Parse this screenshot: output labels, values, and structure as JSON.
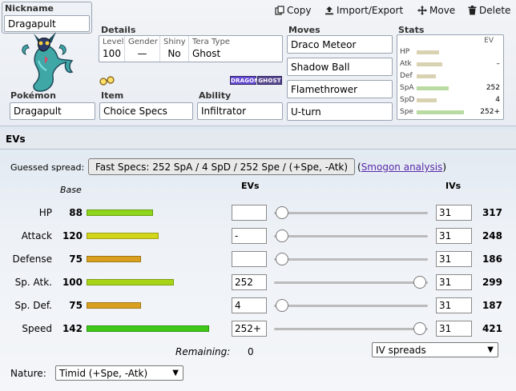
{
  "toolbar": {
    "copy": "Copy",
    "import_export": "Import/Export",
    "move": "Move",
    "delete": "Delete"
  },
  "nickname": {
    "label": "Nickname",
    "value": "Dragapult"
  },
  "details": {
    "label": "Details",
    "level_label": "Level",
    "level": "100",
    "gender_label": "Gender",
    "gender": "—",
    "shiny_label": "Shiny",
    "shiny": "No",
    "tera_label": "Tera Type",
    "tera": "Ghost"
  },
  "types": [
    {
      "name": "DRAGON",
      "color": "#6a4bd6"
    },
    {
      "name": "GHOST",
      "color": "#5b4a8f"
    }
  ],
  "pokemon": {
    "label": "Pokémon",
    "value": "Dragapult"
  },
  "item": {
    "label": "Item",
    "value": "Choice Specs"
  },
  "ability": {
    "label": "Ability",
    "value": "Infiltrator"
  },
  "moves": {
    "label": "Moves",
    "list": [
      "Draco Meteor",
      "Shadow Ball",
      "Flamethrower",
      "U-turn"
    ]
  },
  "stats_mini": {
    "label": "Stats",
    "ev_header": "EV",
    "rows": [
      {
        "name": "HP",
        "bar": 0.45,
        "ev": ""
      },
      {
        "name": "Atk",
        "bar": 0.52,
        "ev": "–"
      },
      {
        "name": "Def",
        "bar": 0.38,
        "ev": ""
      },
      {
        "name": "SpA",
        "bar": 0.65,
        "ev": "252"
      },
      {
        "name": "SpD",
        "bar": 0.4,
        "ev": "4"
      },
      {
        "name": "Spe",
        "bar": 0.95,
        "ev": "252+"
      }
    ]
  },
  "evs_panel": {
    "title": "EVs",
    "guessed_label": "Guessed spread:",
    "guessed_value": "Fast Specs: 252 SpA / 4 SpD / 252 Spe / (+Spe, -Atk)",
    "paren_open": "(",
    "smogon_link": "Smogon analysis",
    "paren_close": ")",
    "base_header": "Base",
    "evs_header": "EVs",
    "ivs_header": "IVs",
    "stats": [
      {
        "name": "HP",
        "base": "88",
        "base_frac": 0.336,
        "color": "#8ed41a",
        "ev": "",
        "ev_frac": 0.0,
        "iv": "31",
        "total": "317"
      },
      {
        "name": "Attack",
        "base": "120",
        "base_frac": 0.366,
        "color": "#d2d61a",
        "ev": "-",
        "ev_frac": 0.0,
        "iv": "31",
        "total": "248"
      },
      {
        "name": "Defense",
        "base": "75",
        "base_frac": 0.275,
        "color": "#d8a01e",
        "ev": "",
        "ev_frac": 0.0,
        "iv": "31",
        "total": "186"
      },
      {
        "name": "Sp. Atk.",
        "base": "100",
        "base_frac": 0.443,
        "color": "#a8d418",
        "ev": "252",
        "ev_frac": 1.0,
        "iv": "31",
        "total": "299"
      },
      {
        "name": "Sp. Def.",
        "base": "75",
        "base_frac": 0.275,
        "color": "#d8a01e",
        "ev": "4",
        "ev_frac": 0.0,
        "iv": "31",
        "total": "187"
      },
      {
        "name": "Speed",
        "base": "142",
        "base_frac": 0.618,
        "color": "#3ec818",
        "ev": "252+",
        "ev_frac": 1.0,
        "iv": "31",
        "total": "421"
      }
    ],
    "remaining_label": "Remaining:",
    "remaining_value": "0",
    "iv_spreads": "IV spreads",
    "nature_label": "Nature:",
    "nature_value": "Timid (+Spe, -Atk)"
  }
}
